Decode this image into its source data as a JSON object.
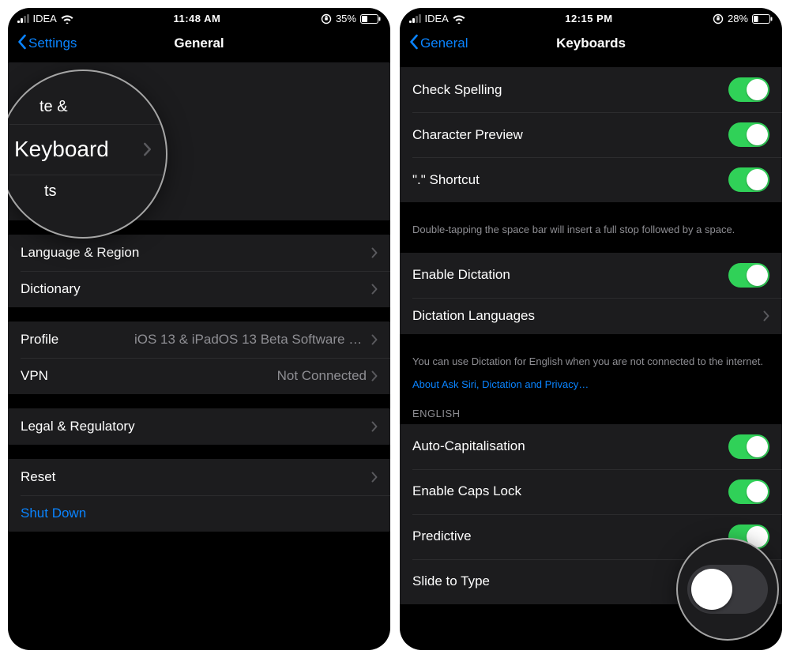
{
  "left": {
    "status": {
      "carrier": "IDEA",
      "time": "11:48 AM",
      "battery_pct": "35%"
    },
    "nav": {
      "back": "Settings",
      "title": "General"
    },
    "magnifier": {
      "frag_top": "te &",
      "main": "Keyboard",
      "frag_bottom": "ts"
    },
    "group1": [
      {
        "label": "Language & Region"
      },
      {
        "label": "Dictionary"
      }
    ],
    "group2": {
      "profile_label": "Profile",
      "profile_value": "iOS 13 & iPadOS 13 Beta Software Pr…",
      "vpn_label": "VPN",
      "vpn_value": "Not Connected"
    },
    "group3": [
      {
        "label": "Legal & Regulatory"
      }
    ],
    "group4": {
      "reset": "Reset",
      "shutdown": "Shut Down"
    }
  },
  "right": {
    "status": {
      "carrier": "IDEA",
      "time": "12:15 PM",
      "battery_pct": "28%"
    },
    "nav": {
      "back": "General",
      "title": "Keyboards"
    },
    "group1": [
      {
        "label": "Check Spelling",
        "on": true
      },
      {
        "label": "Character Preview",
        "on": true
      },
      {
        "label": "\".\" Shortcut",
        "on": true
      }
    ],
    "footer1": "Double-tapping the space bar will insert a full stop followed by a space.",
    "group2": {
      "enable_dictation": "Enable Dictation",
      "dictation_languages": "Dictation Languages"
    },
    "footer2": "You can use Dictation for English when you are not connected to the internet.",
    "footer2_link": "About Ask Siri, Dictation and Privacy…",
    "section_header": "ENGLISH",
    "group3": [
      {
        "label": "Auto-Capitalisation",
        "on": true
      },
      {
        "label": "Enable Caps Lock",
        "on": true
      },
      {
        "label": "Predictive",
        "on": true
      },
      {
        "label": "Slide to Type",
        "on": false
      }
    ]
  }
}
